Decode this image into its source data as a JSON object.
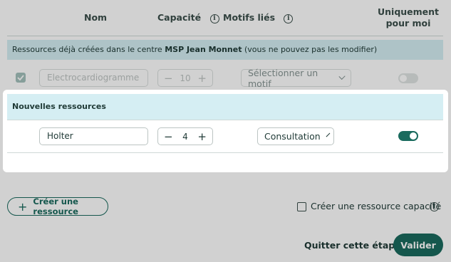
{
  "header": {
    "col_name": "Nom",
    "col_capacity": "Capacité",
    "col_reasons": "Motifs liés",
    "col_only_me_line1": "Uniquement",
    "col_only_me_line2": "pour moi"
  },
  "existing": {
    "banner_prefix": "Ressources déjà créées dans le centre ",
    "banner_center": "MSP Jean Monnet",
    "banner_suffix": " (vous ne pouvez pas les modifier)",
    "row": {
      "checked": true,
      "name": "Electrocardiogramme",
      "capacity": "10",
      "reason": "Sélectionner un motif",
      "only_me": false
    }
  },
  "new_resources": {
    "title": "Nouvelles ressources",
    "row": {
      "name": "Holter",
      "capacity": "4",
      "reason": "Consultation",
      "only_me": true
    }
  },
  "footer": {
    "create_resource": "Créer une ressource",
    "create_capacity_resource": "Créer une ressource capacité",
    "skip_step": "Quitter cette étape",
    "validate": "Valider"
  },
  "icons": {
    "plus": "+",
    "minus": "−",
    "info": "i"
  },
  "colors": {
    "primary": "#1a6b5e",
    "banner": "#d5eef3",
    "toggle_off": "#c8cfcd"
  }
}
